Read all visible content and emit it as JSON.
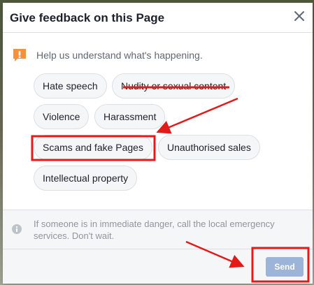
{
  "dialog": {
    "title": "Give feedback on this Page",
    "close_icon": "close-icon"
  },
  "prompt": {
    "icon": "warning-icon",
    "text": "Help us understand what's happening."
  },
  "options": [
    {
      "label": "Hate speech"
    },
    {
      "label": "Nudity or sexual content",
      "struck_out": true
    },
    {
      "label": "Violence"
    },
    {
      "label": "Harassment"
    },
    {
      "label": "Scams and fake Pages",
      "highlighted": true
    },
    {
      "label": "Unauthorised sales"
    },
    {
      "label": "Intellectual property"
    }
  ],
  "info": {
    "icon": "info-icon",
    "text": "If someone is in immediate danger, call the local emergency services. Don't wait."
  },
  "footer": {
    "send_label": "Send"
  },
  "colors": {
    "annotation": "#e41a1a",
    "send_disabled": "#9cb4d8",
    "warning": "#f7923b"
  }
}
